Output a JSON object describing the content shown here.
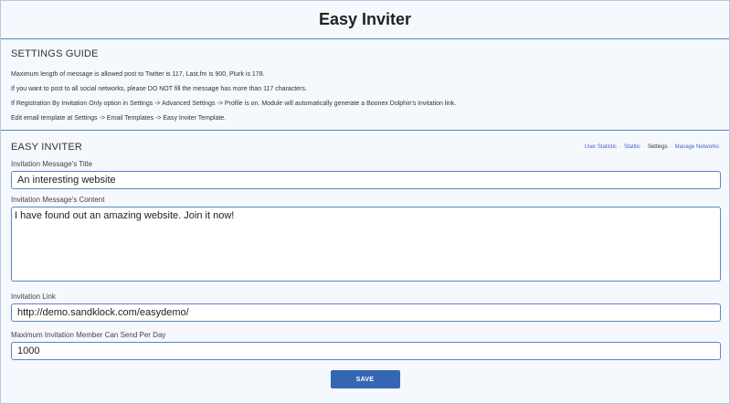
{
  "header": {
    "title": "Easy Inviter"
  },
  "guide": {
    "title": "SETTINGS GUIDE",
    "lines": [
      "Maximum length of message is allowed post to Twitter is 117, Last.fm is 900, Plurk is 178.",
      "If you want to post to all social networks, please DO NOT fill the message has more than 117 characters.",
      "If Registration By Invitation Only option in Settings -> Advanced Settings -> Profile is on. Module will automatically generate a Boonex Dolphin's invitation link.",
      "Edit email template at Settings -> Email Templates -> Easy Inviter Template."
    ]
  },
  "inviter": {
    "title": "EASY INVITER",
    "nav": {
      "user_statistic": "User Statistic",
      "statitic": "Statitic",
      "settings": "Settings",
      "manage_networks": "Manage Networks",
      "separator": "·"
    },
    "fields": {
      "title_label": "Invitation Message's Title",
      "title_value": "An interesting website",
      "content_label": "Invitation Message's Content",
      "content_value": "I have found out an amazing website. Join it now!",
      "link_label": "Invitation Link",
      "link_value": "http://demo.sandklock.com/easydemo/",
      "max_label": "Maximum Invitation Member Can Send Per Day",
      "max_value": "1000"
    },
    "save_label": "SAVE"
  },
  "colors": {
    "accent": "#3466b4",
    "border": "#5b86c6",
    "link": "#4a5fd0",
    "background": "#f5f8fd"
  }
}
